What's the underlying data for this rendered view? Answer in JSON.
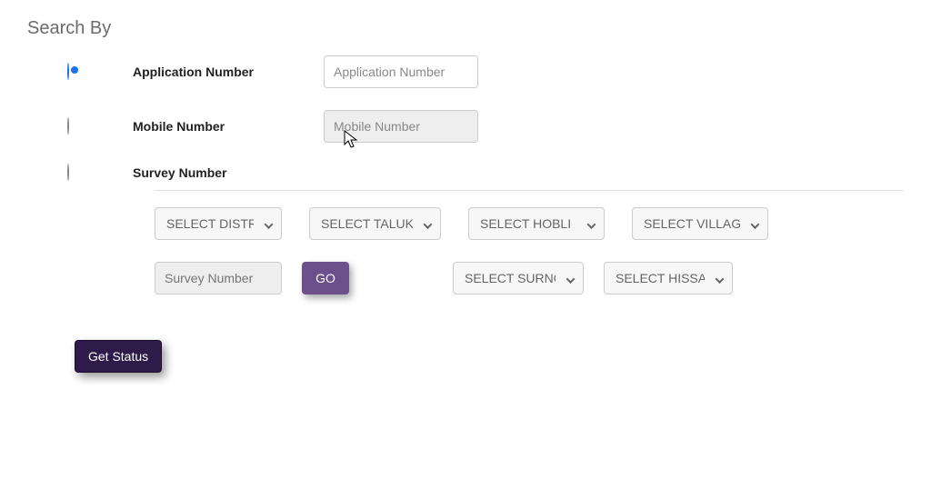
{
  "title": "Search By",
  "options": {
    "application": {
      "label": "Application Number",
      "placeholder": "Application Number",
      "value": ""
    },
    "mobile": {
      "label": "Mobile Number",
      "placeholder": "Mobile Number",
      "value": ""
    },
    "survey": {
      "label": "Survey Number",
      "placeholder": "Survey Number",
      "value": ""
    }
  },
  "selects": {
    "district": "SELECT DISTRICT",
    "taluk": "SELECT TALUK",
    "hobli": "SELECT HOBLI",
    "village": "SELECT VILLAGE",
    "surnoc": "SELECT SURNOC",
    "hissa": "SELECT HISSA"
  },
  "buttons": {
    "go": "GO",
    "get_status": "Get Status"
  },
  "selected_option": "application"
}
